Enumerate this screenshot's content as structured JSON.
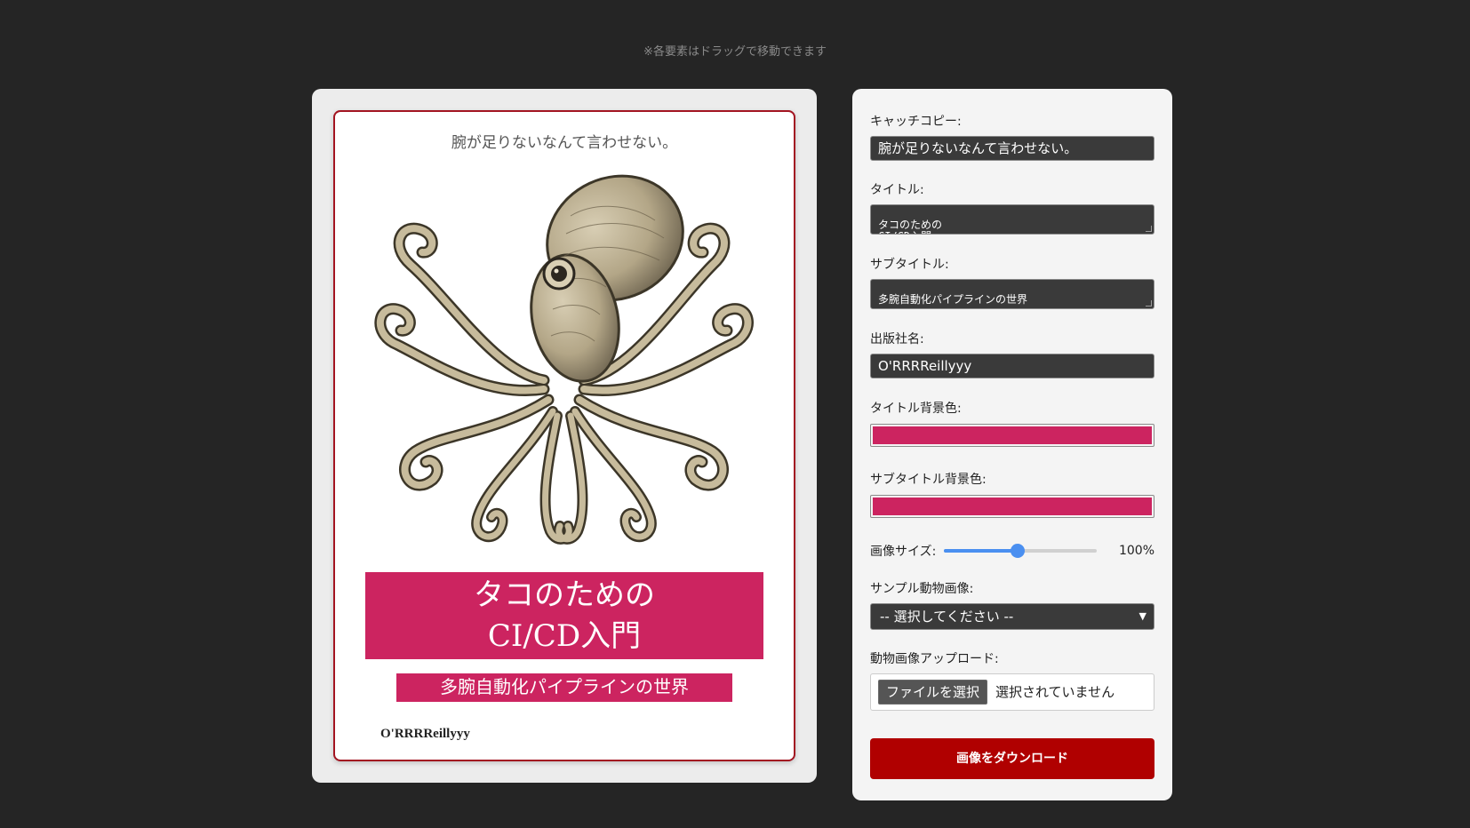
{
  "hint": "※各要素はドラッグで移動できます",
  "cover": {
    "catch": "腕が足りないなんて言わせない。",
    "title": "タコのための\nCI/CD入門",
    "subtitle": "多腕自動化パイプラインの世界",
    "publisher": "O'RRRReillyyy",
    "image_icon": "octopus-illustration"
  },
  "form": {
    "catch_label": "キャッチコピー:",
    "catch_value": "腕が足りないなんて言わせない。",
    "title_label": "タイトル:",
    "title_value": "タコのための\nCI/CD入門",
    "subtitle_label": "サブタイトル:",
    "subtitle_value": "多腕自動化パイプラインの世界",
    "publisher_label": "出版社名:",
    "publisher_value": "O'RRRReillyyy",
    "title_bg_label": "タイトル背景色:",
    "title_bg_color": "#cc2460",
    "subtitle_bg_label": "サブタイトル背景色:",
    "subtitle_bg_color": "#cc2460",
    "image_size_label": "画像サイズ:",
    "image_size_value": "100%",
    "image_size_fraction": 0.48,
    "sample_label": "サンプル動物画像:",
    "sample_selected": "-- 選択してください --",
    "upload_label": "動物画像アップロード:",
    "file_button": "ファイルを選択",
    "file_status": "選択されていません",
    "download_button": "画像をダウンロード"
  }
}
